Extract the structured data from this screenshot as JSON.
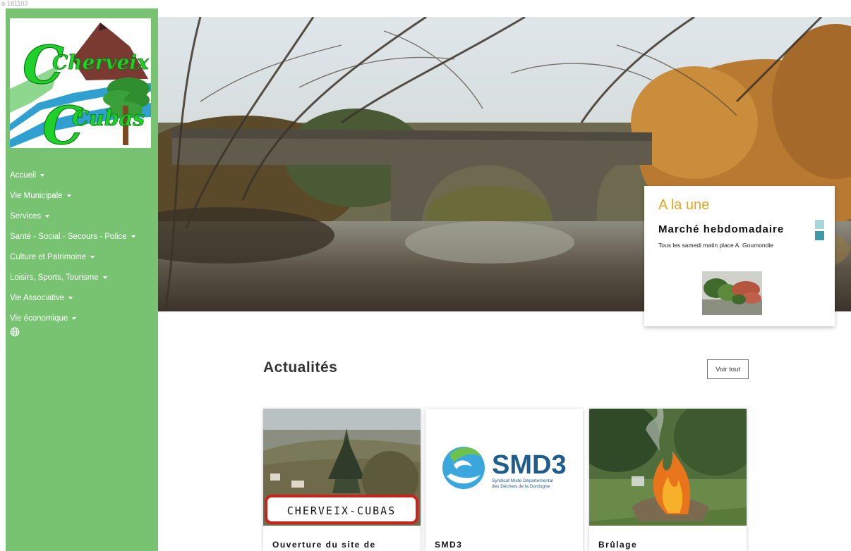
{
  "page_id": "a-181103",
  "sidebar": {
    "logo_line1": "Cherveix",
    "logo_line2": "Cubas",
    "items": [
      {
        "label": "Accueil"
      },
      {
        "label": "Vie Municipale"
      },
      {
        "label": "Services"
      },
      {
        "label": "Santé - Social - Secours - Police"
      },
      {
        "label": "Culture et Patrimoine"
      },
      {
        "label": "Loisirs, Sports, Tourisme"
      },
      {
        "label": "Vie Associative"
      },
      {
        "label": "Vie économique"
      }
    ],
    "language_icon": "globe-icon"
  },
  "une": {
    "heading": "A la une",
    "title": "Marché hebdomadaire",
    "description": "Tous les samedi matin place A. Goumondie",
    "dots": 2,
    "active_dot": 2
  },
  "news": {
    "title": "Actualités",
    "voir_tout": "Voir tout",
    "cards": [
      {
        "title": "Ouverture du site de",
        "sign_text": "CHERVEIX-CUBAS"
      },
      {
        "title": "SMD3",
        "logo_text": "SMD3",
        "logo_sub1": "Syndicat Mixte Départemental",
        "logo_sub2": "des Déchets de la Dordogne"
      },
      {
        "title": "Brûlage"
      }
    ]
  },
  "colors": {
    "sidebar": "#77c372",
    "accent": "#e5a424",
    "dot_light": "#a8d4dc",
    "dot_active": "#3e9aa8"
  }
}
